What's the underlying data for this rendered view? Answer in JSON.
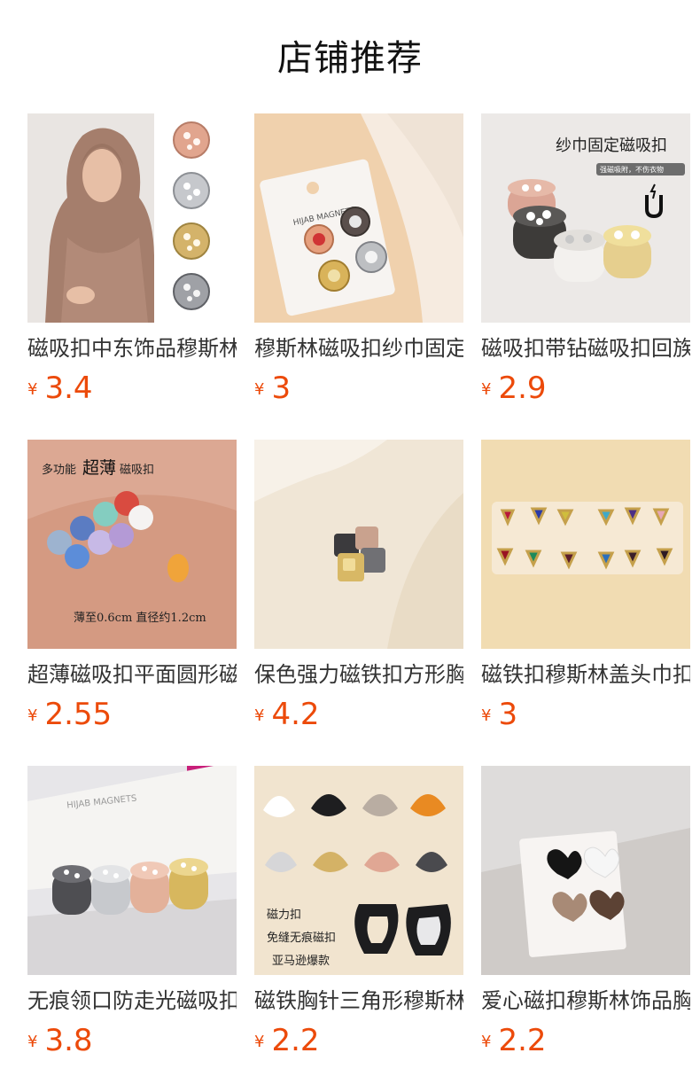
{
  "header": {
    "title": "店铺推荐"
  },
  "products": [
    {
      "name": "磁吸扣中东饰品穆斯林头巾",
      "currency": "¥",
      "price": "3.4",
      "image_text": []
    },
    {
      "name": "穆斯林磁吸扣纱巾固定扣",
      "currency": "¥",
      "price": "3",
      "image_text": [
        "HIJAB MAGNETS"
      ]
    },
    {
      "name": "磁吸扣带钻磁吸扣回族",
      "currency": "¥",
      "price": "2.9",
      "image_text": [
        "纱巾固定磁吸扣",
        "强磁吸附，不伤衣物"
      ]
    },
    {
      "name": "超薄磁吸扣平面圆形磁扣",
      "currency": "¥",
      "price": "2.55",
      "image_text": [
        "多功能",
        "超薄",
        "磁吸扣",
        "薄至0.6cm 直径约1.2cm"
      ]
    },
    {
      "name": "保色强力磁铁扣方形胸针",
      "currency": "¥",
      "price": "4.2",
      "image_text": []
    },
    {
      "name": "磁铁扣穆斯林盖头巾扣",
      "currency": "¥",
      "price": "3",
      "image_text": []
    },
    {
      "name": "无痕领口防走光磁吸扣",
      "currency": "¥",
      "price": "3.8",
      "image_text": [
        "HIJAB MAGNETS"
      ]
    },
    {
      "name": "磁铁胸针三角形穆斯林",
      "currency": "¥",
      "price": "2.2",
      "image_text": [
        "磁力扣",
        "免缝无痕磁扣",
        "亚马逊爆款"
      ]
    },
    {
      "name": "爱心磁扣穆斯林饰品胸针",
      "currency": "¥",
      "price": "2.2",
      "image_text": []
    }
  ],
  "colors": {
    "price": "#ec4a0a",
    "title": "#111111",
    "name": "#333333"
  },
  "icons": {
    "magnet": "magnet-icon"
  }
}
